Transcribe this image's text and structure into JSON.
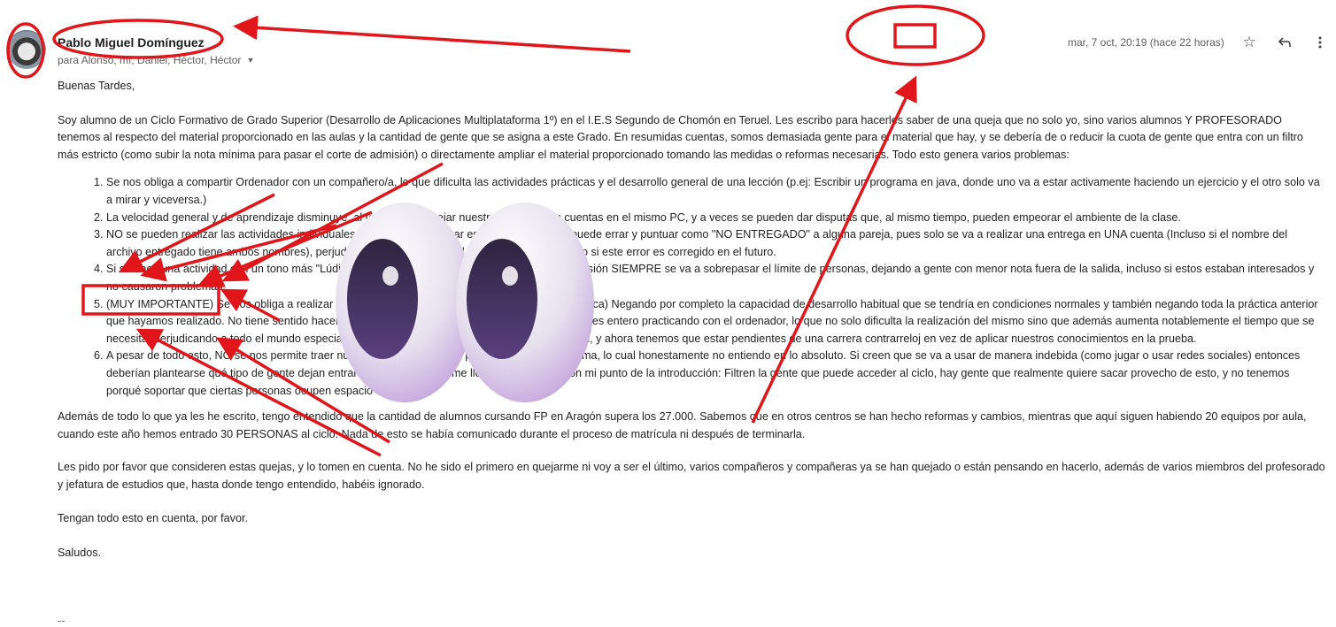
{
  "email": {
    "sender_name": "Pablo Miguel Domínguez",
    "recipients": "para Alonso, mí, Daniel, Héctor, Héctor",
    "timestamp": "mar, 7 oct, 20:19 (hace 22 horas)",
    "greeting": "Buenas Tardes,",
    "intro": "Soy alumno de un Ciclo Formativo de Grado Superior (Desarrollo de Aplicaciones Multiplataforma 1º) en el I.E.S Segundo de Chomón en Teruel. Les escribo para hacerles saber de una queja que no solo yo, sino varios alumnos Y PROFESORADO tenemos al respecto del material proporcionado en las aulas y la cantidad de gente que se asigna a este Grado. En resumidas cuentas, somos demasiada gente para el material que hay, y se debería de o reducir la cuota de gente que entra con un filtro más estricto (como subir la nota mínima para pasar el corte de admisión) o directamente ampliar el material proporcionado tomando las medidas o reformas necesarias. Todo esto genera varios problemas:",
    "issues": [
      "Se nos obliga a compartir Ordenador con un compañero/a, lo que dificulta las actividades prácticas y el desarrollo general de una lección (p.ej: Escribir un programa en java, donde uno va a estar activamente haciendo un ejercicio y el otro solo va a mirar y viceversa.)",
      "La velocidad general y de aprendizaje disminuye, al tener que manejar nuestras respectivas cuentas en el mismo PC, y a veces se pueden dar disputas que, al mismo tiempo, pueden empeorar el ambiente de la clase.",
      "NO se pueden realizar las actividades individuales como tal, y al evaluar estas el profesorado puede errar y puntuar como \"NO ENTREGADO\" a alguna pareja, pues solo se va a realizar una entrega en UNA cuenta (Incluso si el nombre del archivo entregado tiene ambos nombres), perjudicando y apareciendo al alumno afectado incluso si este error es corregido en el futuro.",
      "Si se hace una actividad con un tono más \"Lúdico\" o de excursión, si se realiza una salida / excursión SIEMPRE se va a sobrepasar el límite de personas, dejando a gente con menor nota fuera de la salida, incluso si estos estaban interesados y no causaron problemas.",
      "(MUY IMPORTANTE) Se nos obliga a realizar los exámenes en papel (siendo un ciclo de informática) Negando por completo la capacidad de desarrollo habitual que se tendría en condiciones normales y también negando toda la práctica anterior que hayamos realizado. No tiene sentido hacer un examen de BBDD en papel cuando llevas un mes entero practicando con el ordenador, lo que no solo dificulta la realización del mismo sino que además aumenta notablemente el tiempo que se necesita, perjudicando a todo el mundo especialmente aquellos que nos lo hemos preparado bien, y ahora tenemos que estar pendientes de una carrera contrarreloj en vez de aplicar nuestros conocimientos en la prueba.",
      "A pesar de todo esto, NO se nos permite traer nuestro propio ordenador para solventar el problema, lo cual honestamente no entiendo en lo absoluto. Si creen que se va a usar de manera indebida (como jugar o usar redes sociales) entonces deberían plantearse qué tipo de gente dejan entrar en el ciclo, lo cual me lleva directamente con mi punto de la introducción: Filtren la gente que puede acceder al ciclo, hay gente que realmente quiere sacar provecho de esto, y no tenemos porqué soportar que ciertas personas ocupen espacio sin sentido."
    ],
    "paragraph_1": "Además de todo lo que ya les he escrito, tengo entendido que la cantidad de alumnos cursando FP en Aragón  supera los 27.000. Sabemos que en otros centros se han hecho reformas y cambios, mientras que aquí siguen habiendo 20 equipos por aula, cuando este año hemos entrado 30 PERSONAS al ciclo. Nada de esto se había comunicado durante el proceso de matrícula ni después de terminarla.",
    "paragraph_2": "Les pido por favor que consideren estas quejas, y lo tomen en cuenta. No he sido el primero en quejarme ni voy a ser el último, varios compañeros y compañeras ya se han quejado o están pensando en hacerlo, además de varios miembros del profesorado y jefatura de estudios que, hasta donde tengo entendido, habéis ignorado.",
    "closing_1": "Tengan todo esto en cuenta, por favor.",
    "closing_2": "Saludos.",
    "signature": "--"
  },
  "icons": {
    "star": "star-icon",
    "reply": "reply-icon",
    "more": "more-vertical-icon"
  },
  "colors": {
    "annotation_red": "#e0161b",
    "text": "#222222",
    "muted": "#5e5e5e"
  }
}
